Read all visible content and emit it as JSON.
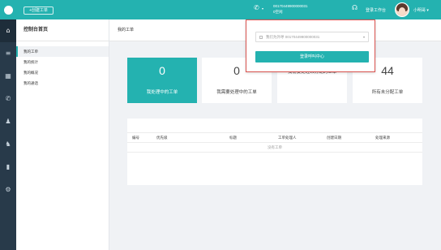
{
  "topbar": {
    "create_button": "+创建工单",
    "phone_caret": "▾",
    "numbers": [
      "00170449900000031",
      "0空闲"
    ],
    "login_label": "登录工作台",
    "user_name": "小明哥 ▾"
  },
  "rail": {
    "icons": [
      "home-icon",
      "list-icon",
      "document-icon",
      "phone-icon",
      "user-icon",
      "users-icon",
      "bar-chart-icon",
      "settings-icon"
    ],
    "glyphs": [
      "⌂",
      "≡",
      "▦",
      "✆",
      "♟",
      "♞",
      "▮",
      "⚙"
    ]
  },
  "menu": {
    "title": "控制台首页",
    "items": [
      "我的工单",
      "我的统计",
      "我的概况",
      "我的通话"
    ]
  },
  "breadcrumb": "我的工单",
  "cards": [
    {
      "value": "0",
      "label": "我处理中的工单",
      "active": true
    },
    {
      "value": "0",
      "label": "我需要处理中的工单",
      "active": false
    },
    {
      "value": "",
      "label": "我需要处理未分配的工单",
      "active": false
    },
    {
      "value": "44",
      "label": "所有未分配工单",
      "active": false
    }
  ],
  "table": {
    "columns": [
      "编号",
      "优先级",
      "标题",
      "工单处理人",
      "创建日期",
      "处理来源"
    ],
    "empty_text": "没有工单"
  },
  "popover": {
    "select_value": "我们为外呼 00170449900000031",
    "select_caret": "▾",
    "button_label": "登录呼叫中心"
  },
  "colors": {
    "accent": "#24b2b0",
    "rail": "#283a4a",
    "popover_border": "#d9534f"
  }
}
